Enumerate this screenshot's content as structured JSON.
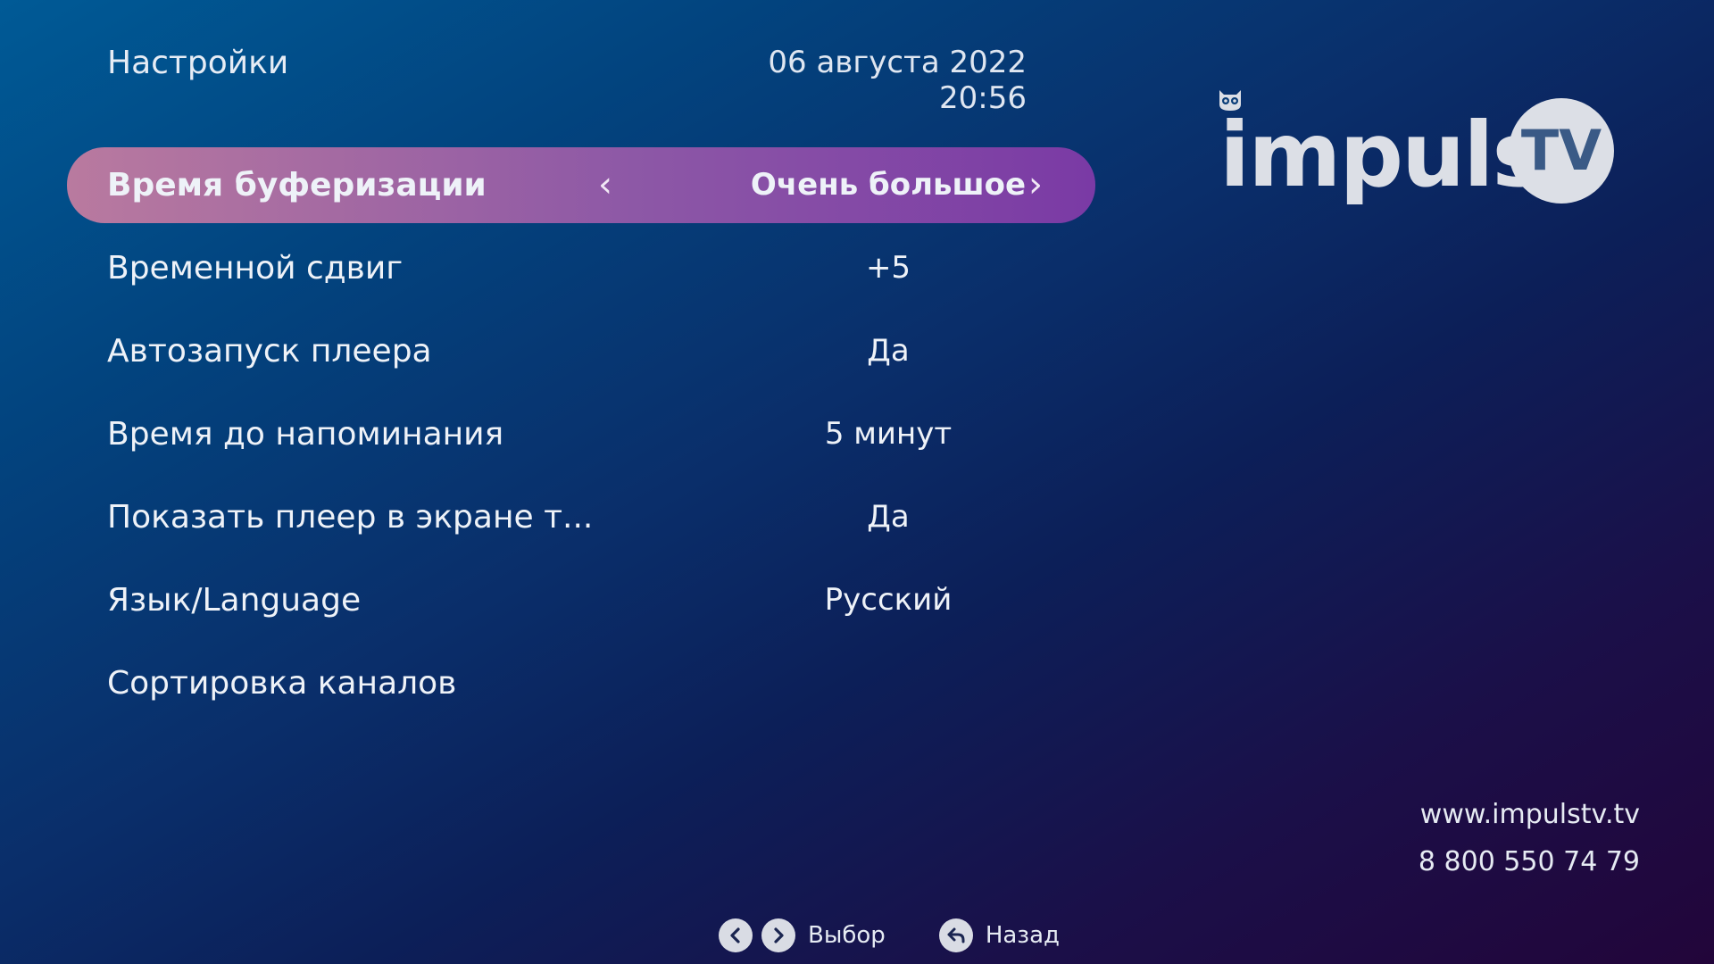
{
  "header": {
    "title": "Настройки",
    "datetime": "06 августа 2022 20:56"
  },
  "settings": {
    "items": [
      {
        "label": "Время буферизации",
        "value": "Очень большое",
        "selected": true
      },
      {
        "label": "Временной сдвиг",
        "value": "+5"
      },
      {
        "label": "Автозапуск плеера",
        "value": "Да"
      },
      {
        "label": "Время до напоминания",
        "value": "5 минут"
      },
      {
        "label": "Показать плеер в экране т...",
        "value": "Да"
      },
      {
        "label": "Язык/Language",
        "value": "Русский"
      },
      {
        "label": "Сортировка каналов",
        "value": ""
      }
    ],
    "prev_arrow": "‹",
    "next_arrow": "›"
  },
  "logo": {
    "text": "impuls",
    "badge": "TV"
  },
  "contacts": {
    "url": "www.impulstv.tv",
    "phone": "8 800 550 74 79"
  },
  "footer": {
    "select_label": "Выбор",
    "back_label": "Назад"
  },
  "colors": {
    "selected_row_start": "#b97a9f",
    "selected_row_end": "#7a3aa5",
    "background_top": "#005a96",
    "background_bottom": "#22053a"
  }
}
